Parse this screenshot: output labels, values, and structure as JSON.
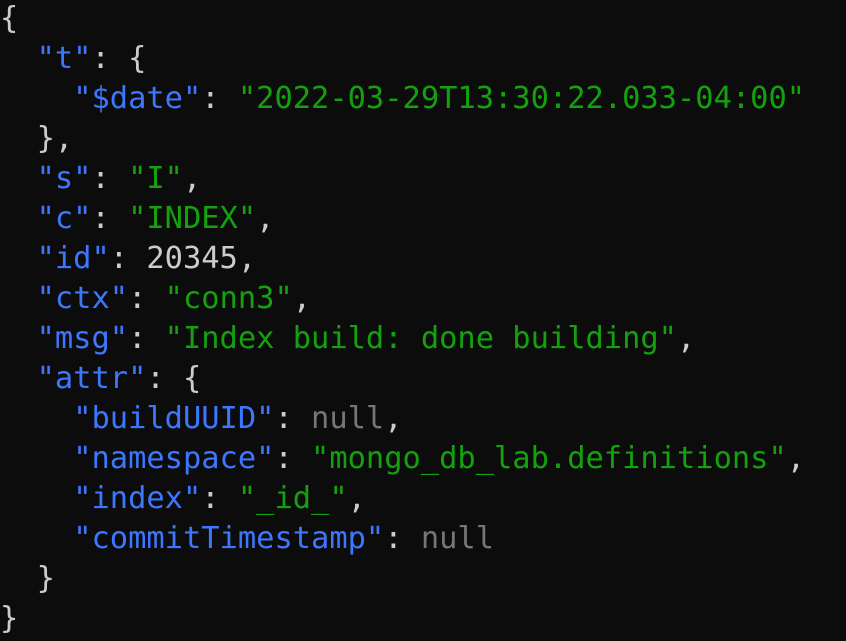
{
  "colors": {
    "background": "#0c0c0c",
    "key": "#3b78ff",
    "string": "#13a10e",
    "number": "#cccccc",
    "null": "#767676",
    "punctuation": "#cccccc"
  },
  "lines": [
    {
      "name": "line-open-brace",
      "tokens": [
        {
          "type": "punct",
          "text": "{"
        }
      ]
    },
    {
      "name": "line-t",
      "tokens": [
        {
          "type": "punct",
          "text": "  "
        },
        {
          "type": "key",
          "text": "\"t\""
        },
        {
          "type": "punct",
          "text": ": {"
        }
      ]
    },
    {
      "name": "line-date",
      "tokens": [
        {
          "type": "punct",
          "text": "    "
        },
        {
          "type": "key",
          "text": "\"$date\""
        },
        {
          "type": "punct",
          "text": ": "
        },
        {
          "type": "string",
          "text": "\"2022-03-29T13:30:22.033-04:00\""
        }
      ]
    },
    {
      "name": "line-close-t",
      "tokens": [
        {
          "type": "punct",
          "text": "  },"
        }
      ]
    },
    {
      "name": "line-s",
      "tokens": [
        {
          "type": "punct",
          "text": "  "
        },
        {
          "type": "key",
          "text": "\"s\""
        },
        {
          "type": "punct",
          "text": ": "
        },
        {
          "type": "string",
          "text": "\"I\""
        },
        {
          "type": "punct",
          "text": ","
        }
      ]
    },
    {
      "name": "line-c",
      "tokens": [
        {
          "type": "punct",
          "text": "  "
        },
        {
          "type": "key",
          "text": "\"c\""
        },
        {
          "type": "punct",
          "text": ": "
        },
        {
          "type": "string",
          "text": "\"INDEX\""
        },
        {
          "type": "punct",
          "text": ","
        }
      ]
    },
    {
      "name": "line-id",
      "tokens": [
        {
          "type": "punct",
          "text": "  "
        },
        {
          "type": "key",
          "text": "\"id\""
        },
        {
          "type": "punct",
          "text": ": "
        },
        {
          "type": "number",
          "text": "20345"
        },
        {
          "type": "punct",
          "text": ","
        }
      ]
    },
    {
      "name": "line-ctx",
      "tokens": [
        {
          "type": "punct",
          "text": "  "
        },
        {
          "type": "key",
          "text": "\"ctx\""
        },
        {
          "type": "punct",
          "text": ": "
        },
        {
          "type": "string",
          "text": "\"conn3\""
        },
        {
          "type": "punct",
          "text": ","
        }
      ]
    },
    {
      "name": "line-msg",
      "tokens": [
        {
          "type": "punct",
          "text": "  "
        },
        {
          "type": "key",
          "text": "\"msg\""
        },
        {
          "type": "punct",
          "text": ": "
        },
        {
          "type": "string",
          "text": "\"Index build: done building\""
        },
        {
          "type": "punct",
          "text": ","
        }
      ]
    },
    {
      "name": "line-attr",
      "tokens": [
        {
          "type": "punct",
          "text": "  "
        },
        {
          "type": "key",
          "text": "\"attr\""
        },
        {
          "type": "punct",
          "text": ": {"
        }
      ]
    },
    {
      "name": "line-builduuid",
      "tokens": [
        {
          "type": "punct",
          "text": "    "
        },
        {
          "type": "key",
          "text": "\"buildUUID\""
        },
        {
          "type": "punct",
          "text": ": "
        },
        {
          "type": "null",
          "text": "null"
        },
        {
          "type": "punct",
          "text": ","
        }
      ]
    },
    {
      "name": "line-namespace",
      "tokens": [
        {
          "type": "punct",
          "text": "    "
        },
        {
          "type": "key",
          "text": "\"namespace\""
        },
        {
          "type": "punct",
          "text": ": "
        },
        {
          "type": "string",
          "text": "\"mongo_db_lab.definitions\""
        },
        {
          "type": "punct",
          "text": ","
        }
      ]
    },
    {
      "name": "line-index",
      "tokens": [
        {
          "type": "punct",
          "text": "    "
        },
        {
          "type": "key",
          "text": "\"index\""
        },
        {
          "type": "punct",
          "text": ": "
        },
        {
          "type": "string",
          "text": "\"_id_\""
        },
        {
          "type": "punct",
          "text": ","
        }
      ]
    },
    {
      "name": "line-committimestamp",
      "tokens": [
        {
          "type": "punct",
          "text": "    "
        },
        {
          "type": "key",
          "text": "\"commitTimestamp\""
        },
        {
          "type": "punct",
          "text": ": "
        },
        {
          "type": "null",
          "text": "null"
        }
      ]
    },
    {
      "name": "line-close-attr",
      "tokens": [
        {
          "type": "punct",
          "text": "  }"
        }
      ]
    },
    {
      "name": "line-close-brace",
      "tokens": [
        {
          "type": "punct",
          "text": "}"
        }
      ]
    }
  ]
}
